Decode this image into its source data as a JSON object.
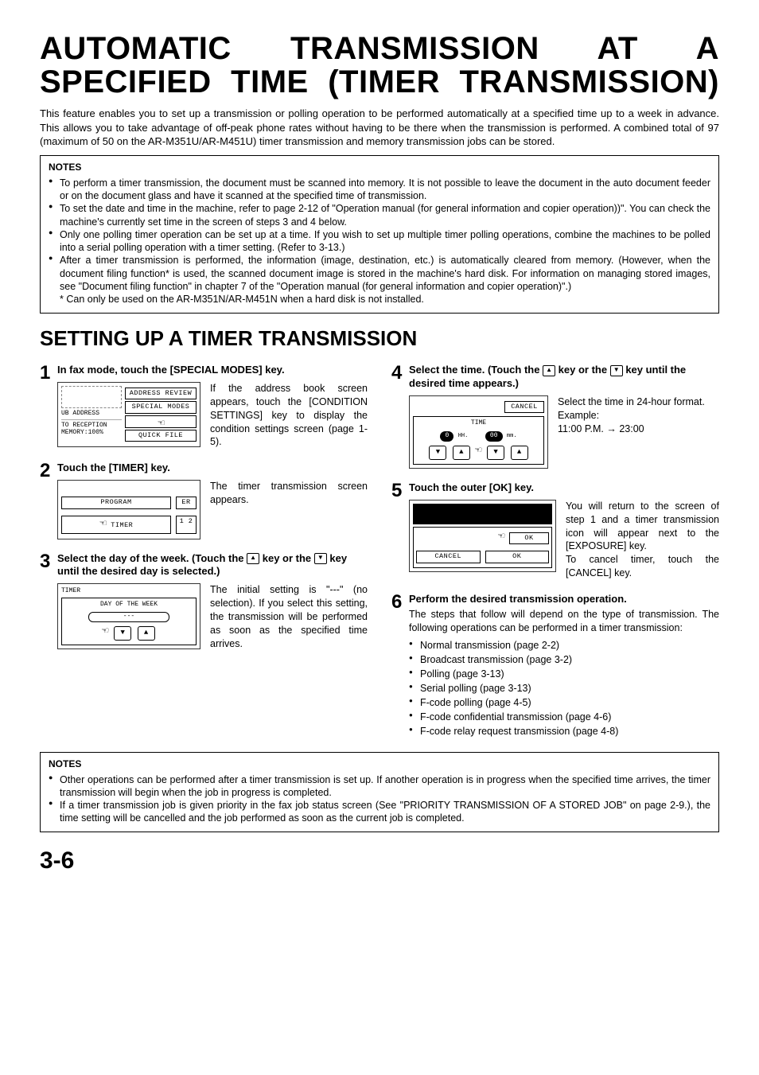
{
  "title": "AUTOMATIC TRANSMISSION AT A SPECIFIED TIME (TIMER TRANSMISSION)",
  "intro": "This feature enables you to set up a transmission or polling operation to be performed automatically at a specified time up to a week in advance.  This allows you to take advantage of off-peak phone rates without having to be there when the transmission is performed. A combined total of 97 (maximum of 50 on the AR-M351U/AR-M451U) timer transmission and memory transmission jobs can be stored.",
  "notes_label": "NOTES",
  "notes1": [
    "To perform a timer transmission, the document must be scanned into memory. It is not possible to leave the document in the auto document feeder or on the document glass and have it scanned at the specified time of transmission.",
    "To set the date and time in the machine, refer to page 2-12 of \"Operation manual (for general information and copier operation))\". You can check the machine's currently set time in the screen of steps 3 and 4 below.",
    "Only one polling timer operation can be set up at a time. If you wish to set up multiple timer polling operations, combine the machines to be polled into a serial polling operation with a timer setting. (Refer to 3-13.)",
    "After a timer transmission is performed, the information (image, destination, etc.) is automatically cleared from memory. (However, when the document filing function* is used, the scanned document image is stored in the machine's hard disk. For information on managing stored images, see \"Document filing function\" in chapter 7 of the \"Operation manual (for general information and copier operation)\".)"
  ],
  "notes1_footnote": "* Can only be used on the AR-M351N/AR-M451N when a hard disk is not installed.",
  "section_heading": "SETTING UP A TIMER TRANSMISSION",
  "step1": {
    "head": "In fax mode, touch the [SPECIAL MODES] key.",
    "text": "If the address book screen appears, touch the [CONDITION SETTINGS] key to display the condition settings screen (page 1-5).",
    "screen": {
      "sub_address": "UB ADDRESS",
      "reception": "TO RECEPTION",
      "memory": "MEMORY:100%",
      "btn1": "ADDRESS REVIEW",
      "btn2": "SPECIAL MODES",
      "btn3": "QUICK FILE"
    }
  },
  "step2": {
    "head": "Touch the [TIMER] key.",
    "text": "The timer transmission screen appears.",
    "screen": {
      "btn1": "PROGRAM",
      "btn2": "ER",
      "btn3": "TIMER",
      "icon": "1 2"
    }
  },
  "step3": {
    "head_prefix": "Select the day of the week. (Touch the ",
    "head_mid": " key or the ",
    "head_suffix": " key until the desired day is selected.)",
    "text": "The initial setting is \"---\" (no selection). If you select this setting, the transmission will be performed as soon as the specified time arrives.",
    "screen": {
      "title": "TIMER",
      "label": "DAY OF THE WEEK",
      "value": "---"
    }
  },
  "step4": {
    "head_prefix": "Select the time. (Touch the ",
    "head_mid": " key or the ",
    "head_suffix": " key until the desired time appears.)",
    "text1": "Select the time in 24-hour format.",
    "text2": "Example:",
    "text3": "11:00 P.M. → 23:00",
    "screen": {
      "cancel": "CANCEL",
      "label": "TIME",
      "hh_val": "0",
      "hh": "HH.",
      "mm_val": "00",
      "mm": "mm."
    }
  },
  "step5": {
    "head": "Touch the outer [OK] key.",
    "text": "You will return to the screen of step 1 and a timer transmission icon will appear next to the [EXPOSURE] key.",
    "text2": "To cancel timer, touch the [CANCEL] key.",
    "screen": {
      "ok1": "OK",
      "cancel": "CANCEL",
      "ok2": "OK"
    }
  },
  "step6": {
    "head": "Perform the desired transmission operation.",
    "text": "The steps that follow will depend on the type of transmission. The following operations can be performed in a timer transmission:",
    "ops": [
      "Normal transmission (page 2-2)",
      "Broadcast transmission (page 3-2)",
      "Polling (page 3-13)",
      "Serial polling (page 3-13)",
      "F-code polling (page 4-5)",
      "F-code confidential transmission (page 4-6)",
      "F-code relay request transmission (page 4-8)"
    ]
  },
  "notes2": [
    "Other operations can be performed after a timer transmission is set up. If another operation is in progress when the specified time arrives, the timer transmission will begin when the job in progress is completed.",
    "If a timer transmission job is given priority in the fax job status screen (See \"PRIORITY TRANSMISSION OF A STORED JOB\" on page 2-9.), the time setting will be cancelled and the job performed as soon as the current job is completed."
  ],
  "page_number": "3-6"
}
